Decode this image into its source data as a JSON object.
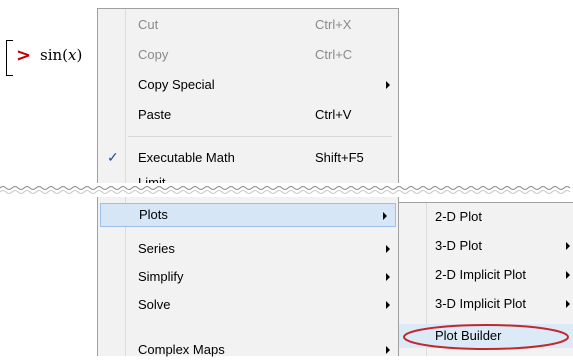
{
  "worksheet": {
    "prompt": ">",
    "expression": "sin(x)",
    "expr_fn": "sin(",
    "expr_var": "x",
    "expr_close": ")"
  },
  "menu_top": [
    {
      "label": "Cut",
      "shortcut": "Ctrl+X",
      "enabled": false
    },
    {
      "label": "Copy",
      "shortcut": "Ctrl+C",
      "enabled": false
    },
    {
      "label": "Copy Special",
      "shortcut": "",
      "enabled": true,
      "submenu": true
    },
    {
      "label": "Paste",
      "shortcut": "Ctrl+V",
      "enabled": true
    },
    {
      "label": "Executable Math",
      "shortcut": "Shift+F5",
      "enabled": true,
      "checked": true
    },
    {
      "label": "Limit",
      "shortcut": "",
      "enabled": true
    }
  ],
  "menu_bottom": [
    {
      "label": "Plots",
      "submenu": true,
      "highlighted": true
    },
    {
      "label": "Series",
      "submenu": true
    },
    {
      "label": "Simplify",
      "submenu": true
    },
    {
      "label": "Solve",
      "submenu": true
    },
    {
      "label": "Complex Maps",
      "submenu": true
    }
  ],
  "plots_submenu": [
    {
      "label": "2-D Plot",
      "submenu": false
    },
    {
      "label": "3-D Plot",
      "submenu": true
    },
    {
      "label": "2-D Implicit Plot",
      "submenu": true
    },
    {
      "label": "3-D Implicit Plot",
      "submenu": true
    },
    {
      "label": "Plot Builder",
      "submenu": false,
      "highlighted": true
    }
  ],
  "checkmark": "✓",
  "colors": {
    "prompt": "#c00000",
    "highlight": "#d6e6f7",
    "ellipse": "#c0282d"
  }
}
